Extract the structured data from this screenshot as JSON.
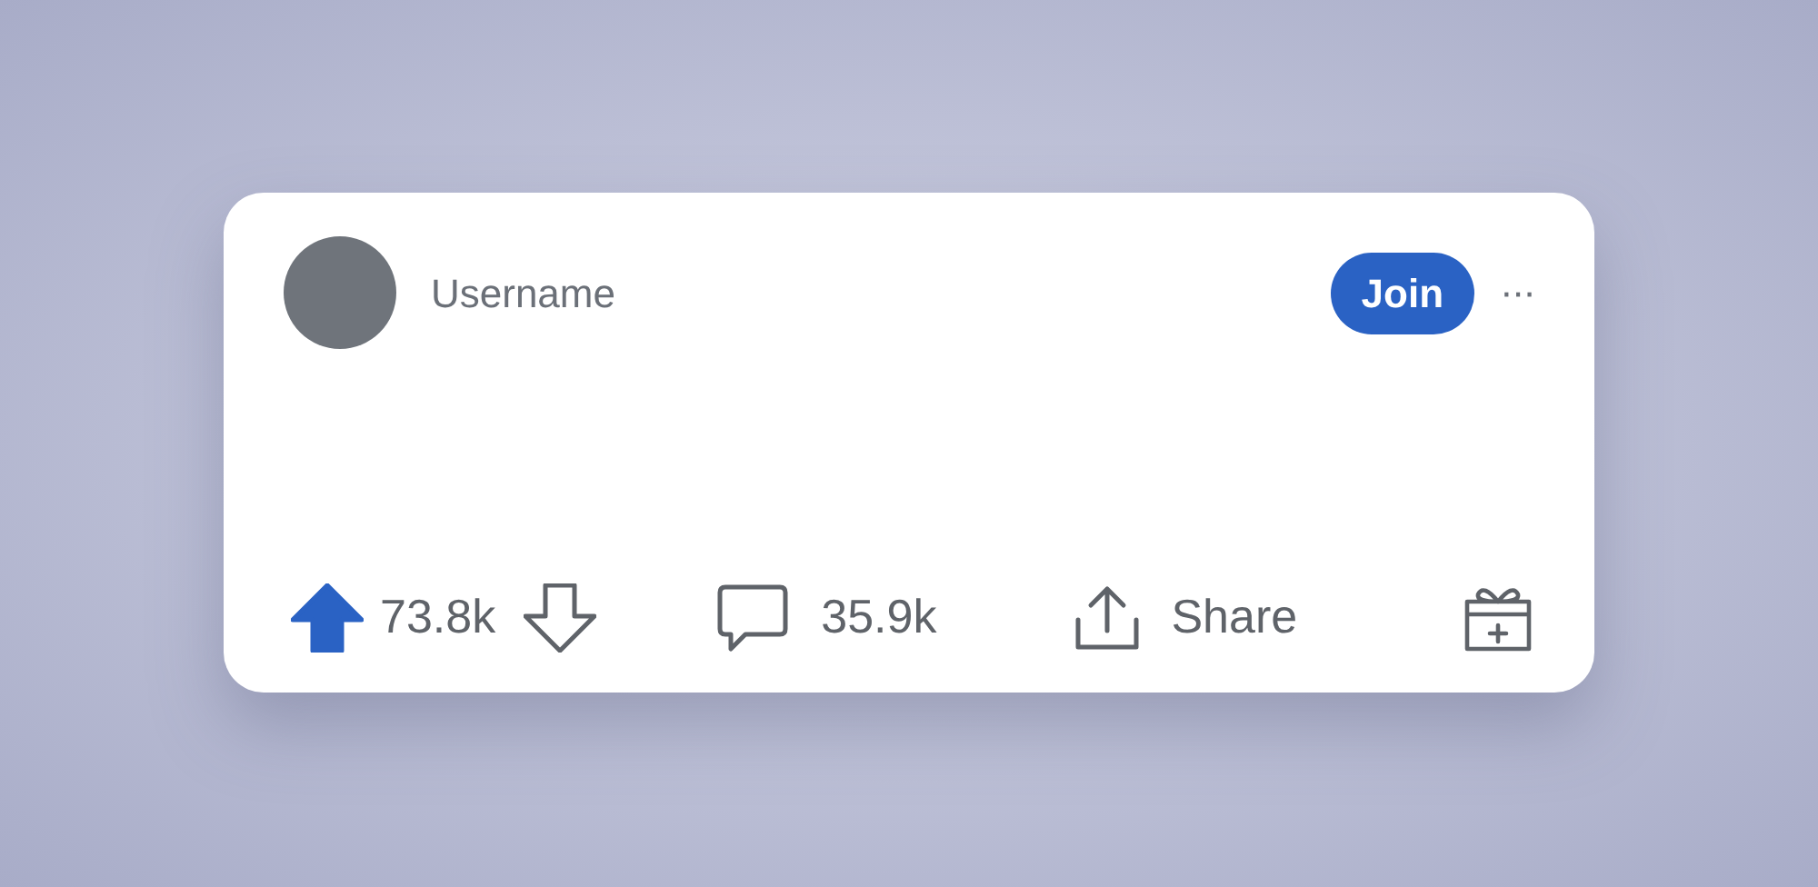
{
  "post": {
    "username": "Username",
    "join_button": "Join",
    "more_button": "···",
    "actions": {
      "upvote_selected": true,
      "downvote_selected": false,
      "vote_count": "73.8k",
      "comment_count": "35.9k",
      "share_label": "Share"
    }
  }
}
